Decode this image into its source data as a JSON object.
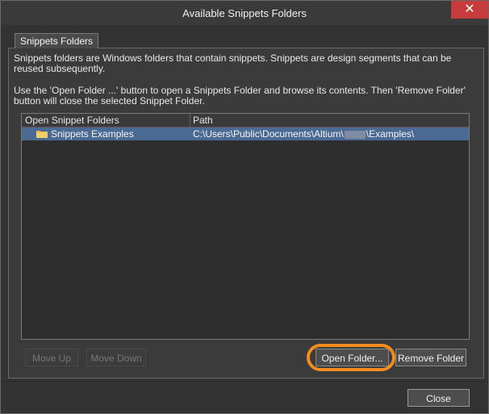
{
  "window": {
    "title": "Available Snippets Folders",
    "close_glyph": "✕"
  },
  "tab": {
    "label": "Snippets Folders"
  },
  "description": {
    "line1": "Snippets folders are Windows folders that contain snippets. Snippets are design segments that can be reused subsequently.",
    "line2": "Use the 'Open Folder ...' button to open a Snippets Folder and browse its contents. Then 'Remove Folder' button will close the selected Snippet Folder."
  },
  "list": {
    "columns": [
      "Open Snippet Folders",
      "Path"
    ],
    "rows": [
      {
        "icon": "folder-icon",
        "name": "Snippets Examples",
        "path_prefix": "C:\\Users\\Public\\Documents\\Altium\\",
        "path_suffix": "\\Examples\\"
      }
    ]
  },
  "buttons": {
    "move_up": "Move Up",
    "move_down": "Move Down",
    "open_folder": "Open Folder...",
    "remove_folder": "Remove Folder",
    "close": "Close"
  },
  "colors": {
    "selection": "#4a6a94",
    "highlight": "#f28c1e",
    "close_button": "#c63b3b",
    "folder_icon": "#e8b84a"
  }
}
